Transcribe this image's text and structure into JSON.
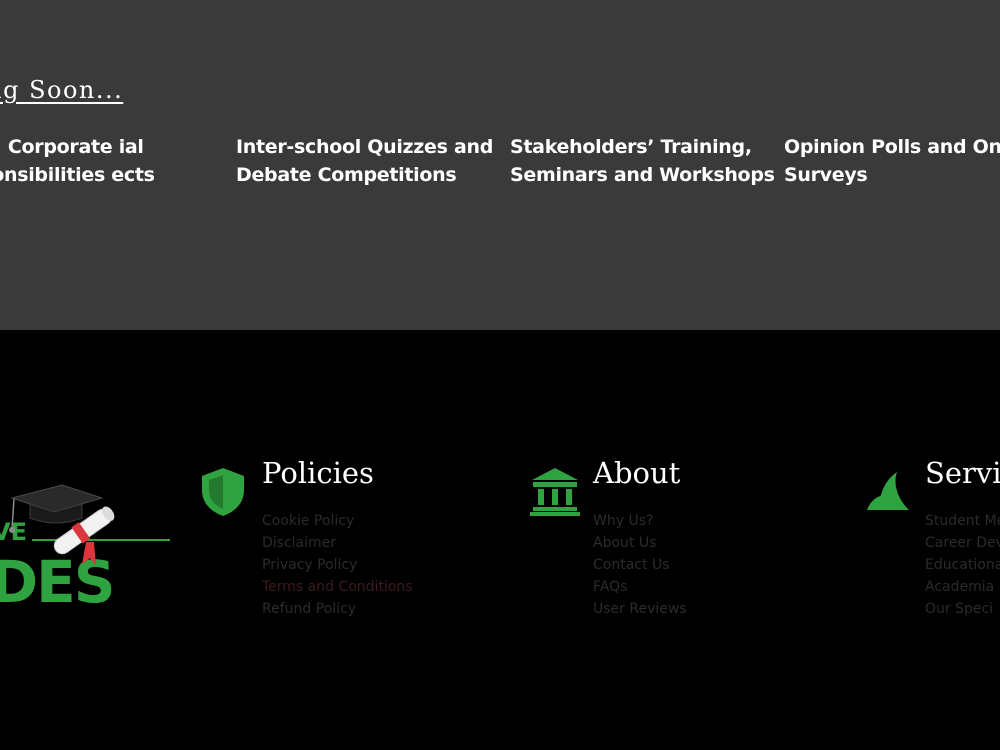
{
  "upcoming": {
    "heading": "ning Soon...",
    "features": [
      "tners’ Corporate ial Responsibilities ects",
      "Inter-school Quizzes and Debate Competitions",
      "Stakeholders’ Training, Seminars and Workshops",
      "Opinion Polls and Onlin Surveys"
    ]
  },
  "footer": {
    "logo": {
      "text": "VE DES",
      "icon": "graduation-cap-diploma-logo"
    },
    "columns": [
      {
        "title": "Policies",
        "icon": "shield-icon",
        "links": [
          "Cookie Policy",
          "Disclaimer",
          "Privacy Policy",
          "Terms and Conditions",
          "Refund Policy"
        ]
      },
      {
        "title": "About",
        "icon": "institution-icon",
        "links": [
          "Why Us?",
          "About Us",
          "Contact Us",
          "FAQs",
          "User Reviews"
        ]
      },
      {
        "title": "Servic",
        "icon": "services-icon",
        "links": [
          "Student Me",
          "Career Dev",
          "Educationa",
          "Academia",
          "Our Speci"
        ]
      }
    ]
  },
  "colors": {
    "upper_background": "#3a3a3a",
    "footer_background": "#000000",
    "accent_green": "#2fa33f",
    "link_text": "#2b2b2b",
    "active_link_text": "#3d1a1f"
  }
}
